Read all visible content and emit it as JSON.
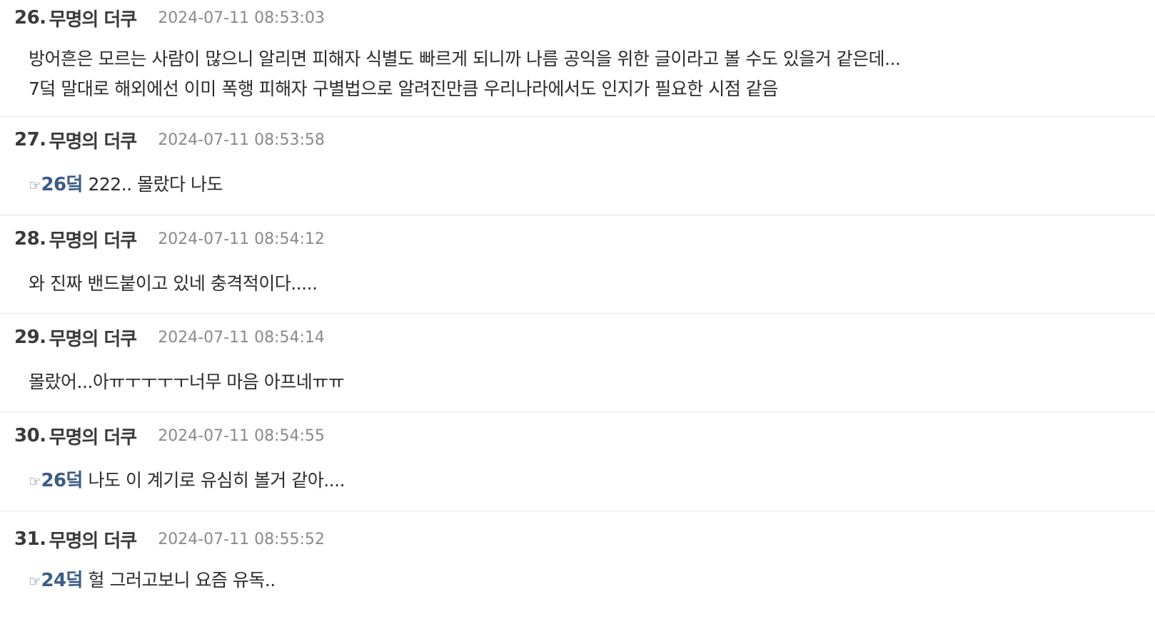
{
  "comments": [
    {
      "number": "26.",
      "author": "무명의 더쿠",
      "time": "2024-07-11 08:53:03",
      "lines": [
        "방어흔은 모르는 사람이 많으니 알리면 피해자 식별도 빠르게 되니까 나름 공익을 위한 글이라고 볼 수도 있을거 같은데...",
        "7덬 말대로 해외에선 이미 폭행 피해자 구별법으로 알려진만큼 우리나라에서도 인지가 필요한 시점 같음"
      ]
    },
    {
      "number": "27.",
      "author": "무명의 더쿠",
      "time": "2024-07-11 08:53:58",
      "reply_icon": "☞",
      "reply_ref": "26덬",
      "text": " 222.. 몰랐다 나도"
    },
    {
      "number": "28.",
      "author": "무명의 더쿠",
      "time": "2024-07-11 08:54:12",
      "lines": [
        "와 진짜 밴드붙이고 있네 충격적이다....."
      ]
    },
    {
      "number": "29.",
      "author": "무명의 더쿠",
      "time": "2024-07-11 08:54:14",
      "lines": [
        "몰랐어...아ㅠㅜㅜㅜㅜ너무 마음 아프네ㅠㅠ"
      ]
    },
    {
      "number": "30.",
      "author": "무명의 더쿠",
      "time": "2024-07-11 08:54:55",
      "reply_icon": "☞",
      "reply_ref": "26덬",
      "text": " 나도 이 계기로 유심히 볼거 같아...."
    },
    {
      "number": "31.",
      "author": "무명의 더쿠",
      "time": "2024-07-11 08:55:52",
      "reply_icon": "☞",
      "reply_ref": "24덬",
      "text": " 헐 그러고보니 요즘 유독.."
    }
  ]
}
